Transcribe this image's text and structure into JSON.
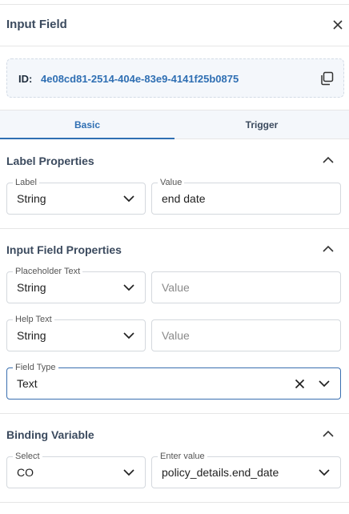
{
  "panel": {
    "title": "Input Field",
    "close_icon": "close-icon"
  },
  "id_box": {
    "label": "ID:",
    "value": "4e08cd81-2514-404e-83e9-4141f25b0875",
    "copy_icon": "copy-icon"
  },
  "tabs": [
    {
      "label": "Basic",
      "active": true
    },
    {
      "label": "Trigger",
      "active": false
    }
  ],
  "label_properties": {
    "title": "Label Properties",
    "label_select": {
      "legend": "Label",
      "value": "String"
    },
    "value_input": {
      "legend": "Value",
      "value": "end date"
    }
  },
  "input_field_properties": {
    "title": "Input Field Properties",
    "placeholder_select": {
      "legend": "Placeholder Text",
      "value": "String"
    },
    "placeholder_value": {
      "placeholder": "Value"
    },
    "help_select": {
      "legend": "Help Text",
      "value": "String"
    },
    "help_value": {
      "placeholder": "Value"
    },
    "field_type": {
      "legend": "Field Type",
      "value": "Text"
    }
  },
  "binding_variable": {
    "title": "Binding Variable",
    "select": {
      "legend": "Select",
      "value": "CO"
    },
    "enter_value": {
      "legend": "Enter value",
      "value": "policy_details.end_date"
    }
  },
  "colors": {
    "accent": "#2f6fb3",
    "heading": "#3b4a5e",
    "border": "#d4d8dd",
    "tab_bg": "#f4f7fb"
  }
}
